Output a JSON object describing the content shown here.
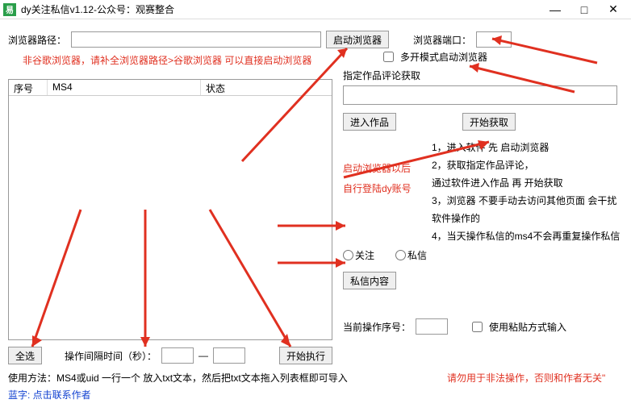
{
  "titlebar": {
    "icon_text": "易",
    "title": "dy关注私信v1.12-公众号：观赛整合"
  },
  "top": {
    "browser_path_label": "浏览器路径：",
    "browser_path_value": "",
    "start_browser_btn": "启动浏览器",
    "browser_port_label": "浏览器端口：",
    "browser_port_value": "",
    "hint_browser": "非谷歌浏览器，请补全浏览器路径>谷歌浏览器 可以直接启动浏览器"
  },
  "table": {
    "col1": "序号",
    "col2": "MS4",
    "col3": "状态"
  },
  "right": {
    "multi_open_label": "多开模式启动浏览器",
    "fieldset_label": "指定作品评论获取",
    "work_url_value": "",
    "enter_work_btn": "进入作品",
    "start_fetch_btn": "开始获取",
    "hint_after_start_1": "启动浏览器以后",
    "hint_after_start_2": "自行登陆dy账号",
    "radio_follow": "关注",
    "radio_dm": "私信",
    "dm_content_btn": "私信内容",
    "instructions": {
      "i1": "1，进入软件 先 启动浏览器",
      "i2": "2，获取指定作品评论，",
      "i2b": "通过软件进入作品 再 开始获取",
      "i3": "3，浏览器 不要手动去访问其他页面 会干扰软件操作的",
      "i4": "4，当天操作私信的ms4不会再重复操作私信"
    },
    "current_seq_label": "当前操作序号：",
    "current_seq_value": "",
    "paste_mode_label": "使用粘贴方式输入"
  },
  "bottom": {
    "select_all_btn": "全选",
    "interval_label": "操作间隔时间（秒）：",
    "interval_min": "",
    "interval_sep": "—",
    "interval_max": "",
    "start_exec_btn": "开始执行"
  },
  "footer": {
    "usage": "使用方法：MS4或uid 一行一个 放入txt文本，然后把txt文本拖入列表框即可导入",
    "warn": "请勿用于非法操作，否则和作者无关\"",
    "contact": "蓝字: 点击联系作者"
  }
}
